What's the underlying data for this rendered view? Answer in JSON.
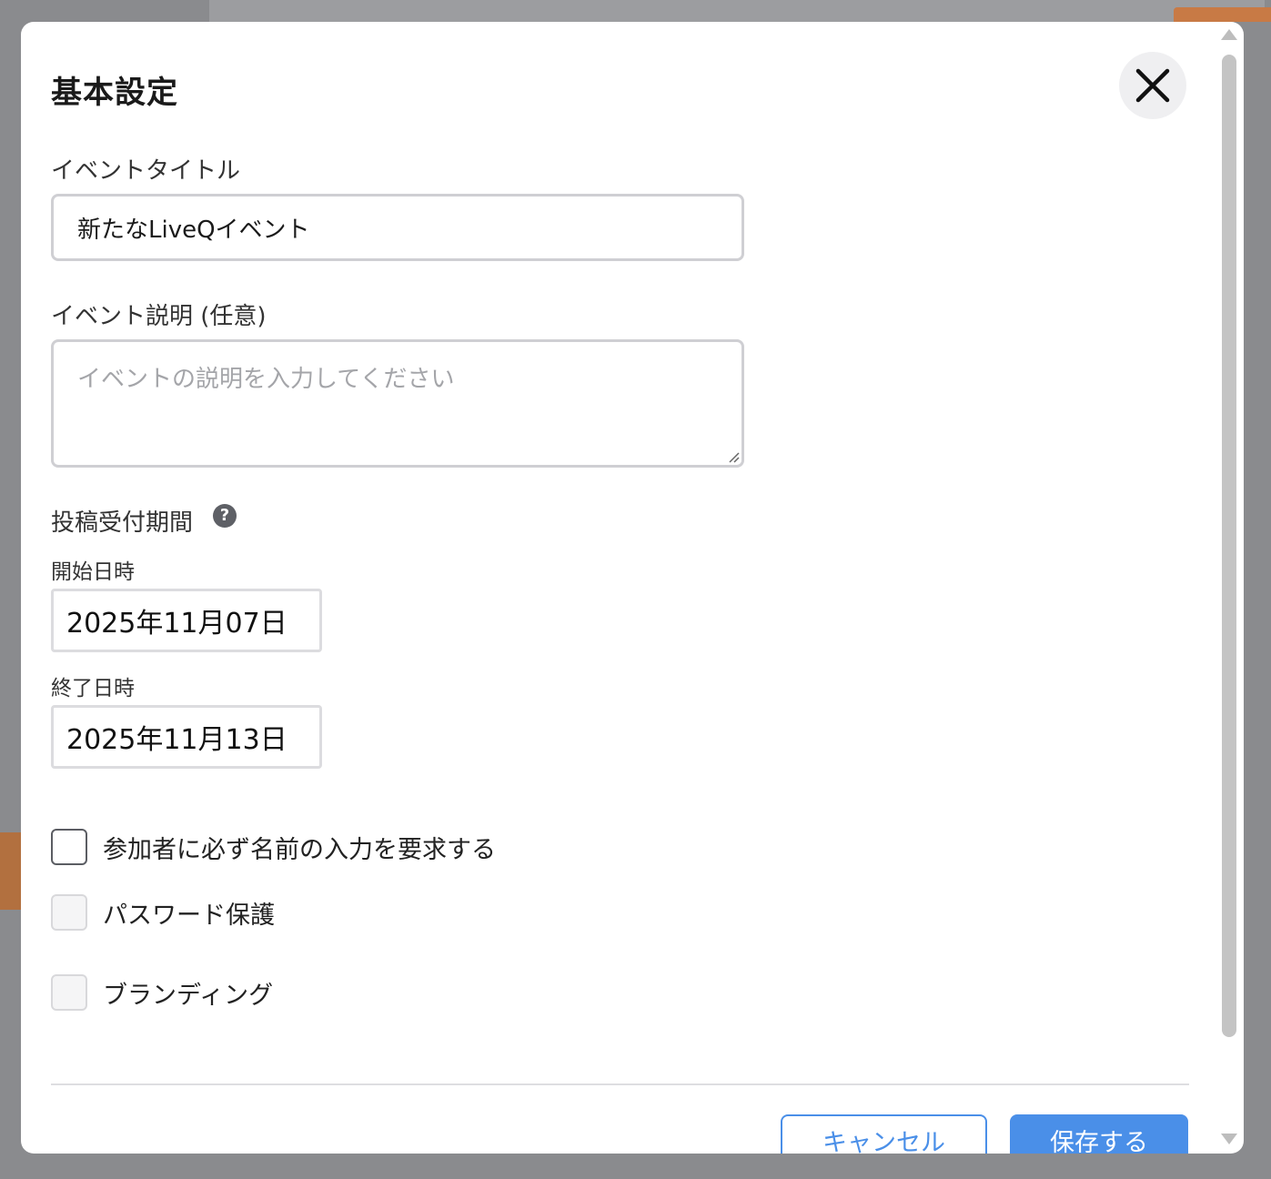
{
  "dialog": {
    "title": "基本設定",
    "close_icon": "close-icon"
  },
  "event_title": {
    "label": "イベントタイトル",
    "value": "新たなLiveQイベント"
  },
  "event_description": {
    "label": "イベント説明 (任意)",
    "placeholder": "イベントの説明を入力してください",
    "value": ""
  },
  "posting_period": {
    "label": "投稿受付期間",
    "help_icon": "question-circle-icon",
    "help_glyph": "?",
    "start": {
      "label": "開始日時",
      "value": "2025年11月07日"
    },
    "end": {
      "label": "終了日時",
      "value": "2025年11月13日"
    }
  },
  "options": [
    {
      "label": "参加者に必ず名前の入力を要求する",
      "checked": false
    },
    {
      "label": "パスワード保護",
      "checked": false
    },
    {
      "label": "ブランディング",
      "checked": false
    }
  ],
  "footer": {
    "cancel_label": "キャンセル",
    "save_label": "保存する"
  },
  "colors": {
    "primary": "#4a8fe8",
    "overlay": "#8a8b8e",
    "border": "#cfcfd3"
  }
}
